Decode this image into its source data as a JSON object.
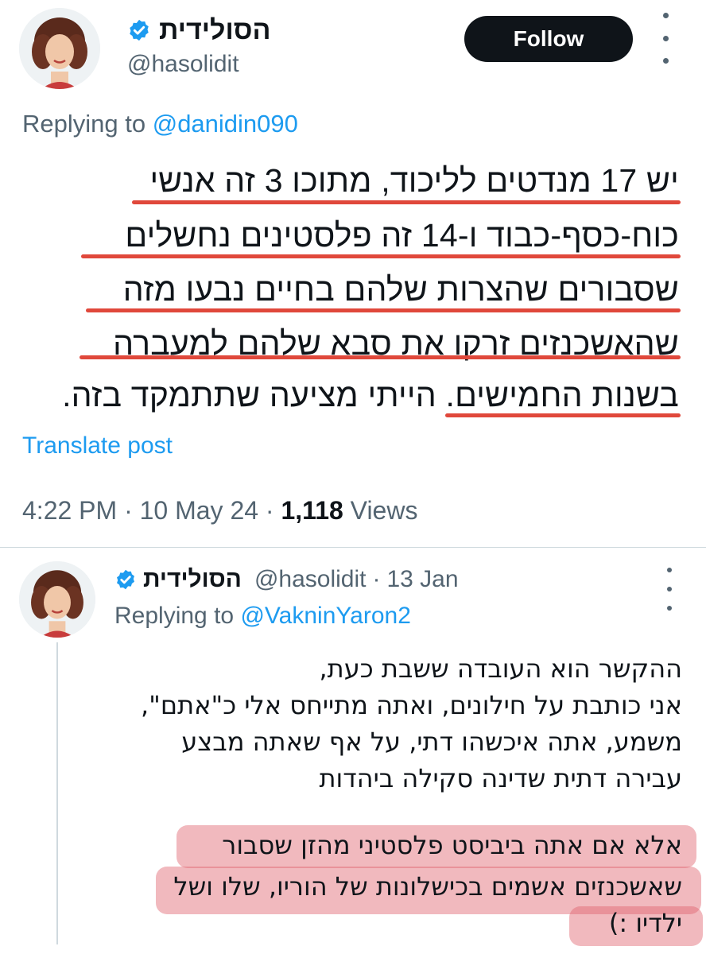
{
  "main_tweet": {
    "author_name": "הסולידית",
    "author_handle": "@hasolidit",
    "follow_label": "Follow",
    "replying_prefix": "Replying to",
    "replying_to": "@danidin090",
    "lines": [
      "יש 17 מנדטים לליכוד, מתוכו 3 זה אנשי",
      "כוח-כסף-כבוד ו-14 זה פלסטינים נחשלים",
      "שסבורים שהצרות שלהם בחיים נבעו מזה",
      "שהאשכנזים זרקו את סבא שלהם למעברה",
      "בשנות החמישים. הייתי מציעה שתתמקד בזה."
    ],
    "translate_label": "Translate post",
    "time": "4:22 PM",
    "date": "10 May 24",
    "views_count": "1,118",
    "views_label": "Views",
    "separator": "·"
  },
  "quoted_reply": {
    "author_name": "הסולידית",
    "author_handle": "@hasolidit",
    "date": "13 Jan",
    "separator": "·",
    "replying_prefix": "Replying to",
    "replying_to": "@VakninYaron2",
    "lines": [
      "ההקשר הוא העובדה ששבת כעת,",
      "אני כותבת על חילונים, ואתה מתייחס אלי כ\"אתם\",",
      "משמע, אתה איכשהו דתי, על אף שאתה מבצע",
      "עבירה דתית שדינה סקילה ביהדות"
    ],
    "highlight_lines": [
      "אלא אם אתה ביביסט פלסטיני מהזן שסבור",
      "שאשכנזים אשמים בכישלונות של הוריו, שלו ושל",
      "ילדיו :)"
    ]
  },
  "colors": {
    "accent": "#1d9bf0",
    "underline": "#e0483b",
    "highlight": "#e0646e"
  },
  "icons": {
    "verified": "verified-badge-icon",
    "more": "more-options-icon"
  }
}
